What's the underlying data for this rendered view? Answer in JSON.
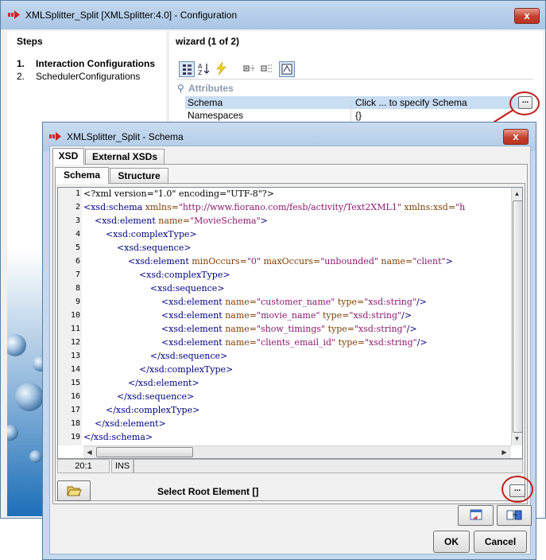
{
  "outer_window": {
    "title": "XMLSplitter_Split [XMLSplitter:4.0] - Configuration",
    "close_label": "x"
  },
  "steps": {
    "title": "Steps",
    "items": [
      {
        "num": "1.",
        "label": "Interaction Configurations",
        "active": true
      },
      {
        "num": "2.",
        "label": "SchedulerConfigurations",
        "active": false
      }
    ]
  },
  "wizard": {
    "title": "wizard (1 of 2)",
    "toolbar_icons": [
      "categorized-view-icon",
      "sort-alpha-icon",
      "lightning-icon",
      "expand-icon",
      "collapse-icon",
      "description-icon"
    ],
    "category": "Attributes",
    "properties": [
      {
        "key": "Schema",
        "value": "Click ... to specify Schema",
        "selected": true
      },
      {
        "key": "Namespaces",
        "value": "{}",
        "selected": false
      }
    ],
    "ellipsis": "..."
  },
  "dialog": {
    "title": "XMLSplitter_Split - Schema",
    "close_label": "x",
    "outer_tabs": [
      "XSD",
      "External XSDs"
    ],
    "inner_tabs": [
      "Schema",
      "Structure"
    ],
    "line_numbers": [
      "1",
      "2",
      "3",
      "4",
      "5",
      "6",
      "7",
      "8",
      "9",
      "10",
      "11",
      "12",
      "13",
      "14",
      "15",
      "16",
      "17",
      "18",
      "19"
    ],
    "status": {
      "position": "20:1",
      "mode": "INS"
    },
    "root_label": "Select Root Element  []",
    "ok": "OK",
    "cancel": "Cancel"
  },
  "code_lines": [
    [
      [
        "t",
        "<?xml version=\"1.0\" encoding=\"UTF-8\"?>"
      ]
    ],
    [
      [
        "g",
        "<xsd:schema "
      ],
      [
        "a",
        "xmlns="
      ],
      [
        "v",
        "\"http://www.fiorano.com/fesb/activity/Text2XML1\" "
      ],
      [
        "a",
        "xmlns:xsd="
      ],
      [
        "v",
        "\"h"
      ]
    ],
    [
      [
        "s",
        "    "
      ],
      [
        "g",
        "<xsd:element "
      ],
      [
        "a",
        "name="
      ],
      [
        "v",
        "\"MovieSchema\""
      ],
      [
        "g",
        ">"
      ]
    ],
    [
      [
        "s",
        "        "
      ],
      [
        "g",
        "<xsd:complexType>"
      ]
    ],
    [
      [
        "s",
        "            "
      ],
      [
        "g",
        "<xsd:sequence>"
      ]
    ],
    [
      [
        "s",
        "                "
      ],
      [
        "g",
        "<xsd:element "
      ],
      [
        "a",
        "minOccurs="
      ],
      [
        "v",
        "\"0\" "
      ],
      [
        "a",
        "maxOccurs="
      ],
      [
        "v",
        "\"unbounded\" "
      ],
      [
        "a",
        "name="
      ],
      [
        "v",
        "\"client\""
      ],
      [
        "g",
        ">"
      ]
    ],
    [
      [
        "s",
        "                    "
      ],
      [
        "g",
        "<xsd:complexType>"
      ]
    ],
    [
      [
        "s",
        "                        "
      ],
      [
        "g",
        "<xsd:sequence>"
      ]
    ],
    [
      [
        "s",
        "                            "
      ],
      [
        "g",
        "<xsd:element "
      ],
      [
        "a",
        "name="
      ],
      [
        "v",
        "\"customer_name\" "
      ],
      [
        "a",
        "type="
      ],
      [
        "v",
        "\"xsd:string\""
      ],
      [
        "g",
        "/>"
      ]
    ],
    [
      [
        "s",
        "                            "
      ],
      [
        "g",
        "<xsd:element "
      ],
      [
        "a",
        "name="
      ],
      [
        "v",
        "\"movie_name\" "
      ],
      [
        "a",
        "type="
      ],
      [
        "v",
        "\"xsd:string\""
      ],
      [
        "g",
        "/>"
      ]
    ],
    [
      [
        "s",
        "                            "
      ],
      [
        "g",
        "<xsd:element "
      ],
      [
        "a",
        "name="
      ],
      [
        "v",
        "\"show_timings\" "
      ],
      [
        "a",
        "type="
      ],
      [
        "v",
        "\"xsd:string\""
      ],
      [
        "g",
        "/>"
      ]
    ],
    [
      [
        "s",
        "                            "
      ],
      [
        "g",
        "<xsd:element "
      ],
      [
        "a",
        "name="
      ],
      [
        "v",
        "\"clients_email_id\" "
      ],
      [
        "a",
        "type="
      ],
      [
        "v",
        "\"xsd:string\""
      ],
      [
        "g",
        "/>"
      ]
    ],
    [
      [
        "s",
        "                        "
      ],
      [
        "g",
        "</xsd:sequence>"
      ]
    ],
    [
      [
        "s",
        "                    "
      ],
      [
        "g",
        "</xsd:complexType>"
      ]
    ],
    [
      [
        "s",
        "                "
      ],
      [
        "g",
        "</xsd:element>"
      ]
    ],
    [
      [
        "s",
        "            "
      ],
      [
        "g",
        "</xsd:sequence>"
      ]
    ],
    [
      [
        "s",
        "        "
      ],
      [
        "g",
        "</xsd:complexType>"
      ]
    ],
    [
      [
        "s",
        "    "
      ],
      [
        "g",
        "</xsd:element>"
      ]
    ],
    [
      [
        "g",
        "</xsd:schema>"
      ]
    ]
  ],
  "colors": {
    "title_bar": "#b1cae8",
    "selection": "#c9ddf3",
    "highlight_ring": "#c0221c",
    "xml_tag": "#000080",
    "xml_attr": "#7f3f00",
    "xml_value": "#8a1a6e"
  }
}
